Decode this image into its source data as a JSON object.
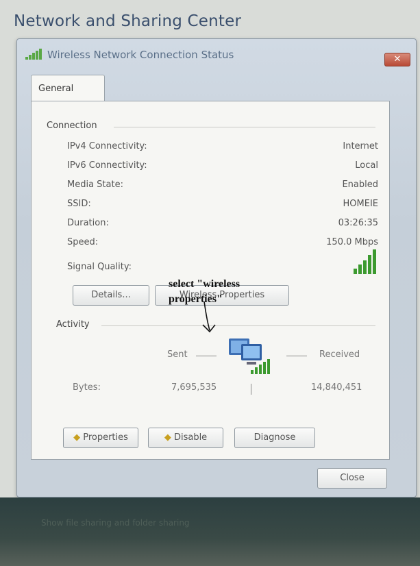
{
  "background_window": {
    "title": "Network and Sharing Center"
  },
  "dialog": {
    "title": "Wireless Network Connection Status",
    "close_label": "✕",
    "tab_label": "General",
    "connection": {
      "group_label": "Connection",
      "rows": [
        {
          "label": "IPv4 Connectivity:",
          "value": "Internet"
        },
        {
          "label": "IPv6 Connectivity:",
          "value": "Local"
        },
        {
          "label": "Media State:",
          "value": "Enabled"
        },
        {
          "label": "SSID:",
          "value": "HOMEIE"
        },
        {
          "label": "Duration:",
          "value": "03:26:35"
        },
        {
          "label": "Speed:",
          "value": "150.0 Mbps"
        }
      ],
      "signal_quality_label": "Signal Quality:",
      "signal_bars_filled": 5,
      "signal_bars_total": 5,
      "details_button": "Details...",
      "wireless_properties_button": "Wireless Properties"
    },
    "activity": {
      "group_label": "Activity",
      "sent_label": "Sent",
      "received_label": "Received",
      "bytes_label": "Bytes:",
      "bytes_sent": "7,695,535",
      "bytes_received": "14,840,451"
    },
    "buttons": {
      "properties": "Properties",
      "disable": "Disable",
      "diagnose": "Diagnose",
      "close": "Close"
    }
  },
  "annotation": {
    "line1": "select \"wireless",
    "line2": "properties\""
  },
  "footer_text": "Show file sharing and folder sharing",
  "colors": {
    "signal_green": "#3c9a2f",
    "dialog_title": "#5a6f88",
    "background_title": "#3a4f6d"
  }
}
